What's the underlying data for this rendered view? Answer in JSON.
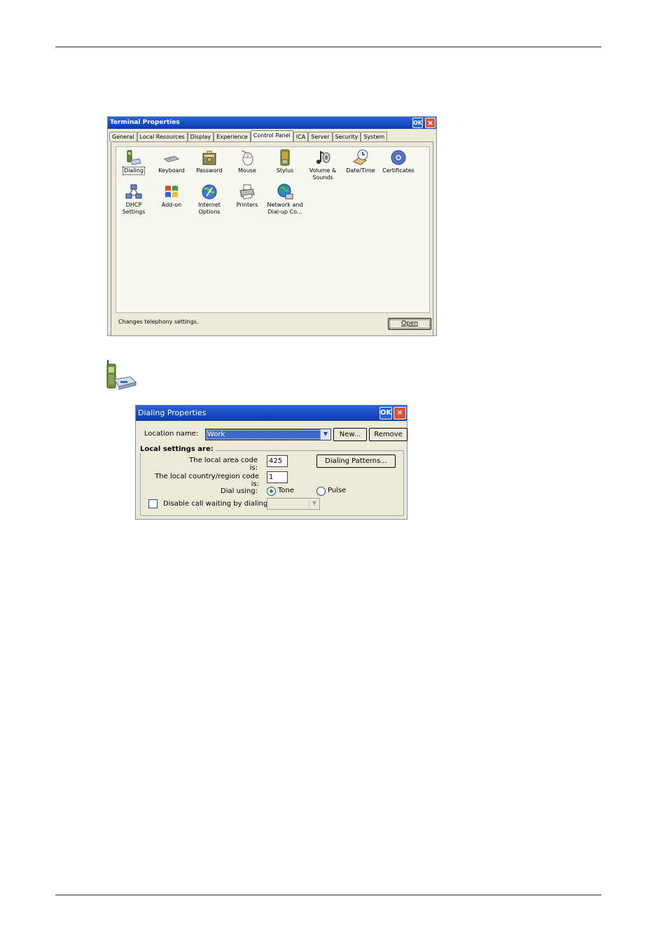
{
  "terminal_window": {
    "title": "Terminal Properties",
    "ok_label": "OK",
    "close_label": "×",
    "tabs": [
      "General",
      "Local Resources",
      "Display",
      "Experience",
      "Control Panel",
      "ICA",
      "Server",
      "Security",
      "System"
    ],
    "active_tab": "Control Panel",
    "items": [
      {
        "label": "Dialing",
        "icon": "dialing-icon"
      },
      {
        "label": "Keyboard",
        "icon": "keyboard-icon"
      },
      {
        "label": "Password",
        "icon": "password-icon"
      },
      {
        "label": "Mouse",
        "icon": "mouse-icon"
      },
      {
        "label": "Stylus",
        "icon": "stylus-icon"
      },
      {
        "label": "Volume & Sounds",
        "icon": "volume-icon"
      },
      {
        "label": "Date/Time",
        "icon": "datetime-icon"
      },
      {
        "label": "Certificates",
        "icon": "certificates-icon"
      },
      {
        "label": "DHCP Settings",
        "icon": "dhcp-icon"
      },
      {
        "label": "Add-on",
        "icon": "addon-icon"
      },
      {
        "label": "Internet Options",
        "icon": "internet-options-icon"
      },
      {
        "label": "Printers",
        "icon": "printer-icon"
      },
      {
        "label": "Network and Dial-up Co...",
        "icon": "network-icon"
      }
    ],
    "status_text": "Changes telephony settings.",
    "open_label": "Open"
  },
  "dialing_window": {
    "title": "Dialing Properties",
    "ok_label": "OK",
    "close_label": "×",
    "location_label": "Location name:",
    "location_value": "Work",
    "new_label": "New...",
    "remove_label": "Remove",
    "group_label": "Local settings are:",
    "area_code_label": "The local area code is:",
    "area_code_value": "425",
    "dialing_patterns_label": "Dialing Patterns...",
    "country_code_label": "The local country/region code is:",
    "country_code_value": "1",
    "dial_using_label": "Dial using:",
    "tone_label": "Tone",
    "pulse_label": "Pulse",
    "selected_dial": "Tone",
    "call_waiting_label": "Disable call waiting by dialing:",
    "call_waiting_checked": false,
    "call_waiting_value": ""
  }
}
